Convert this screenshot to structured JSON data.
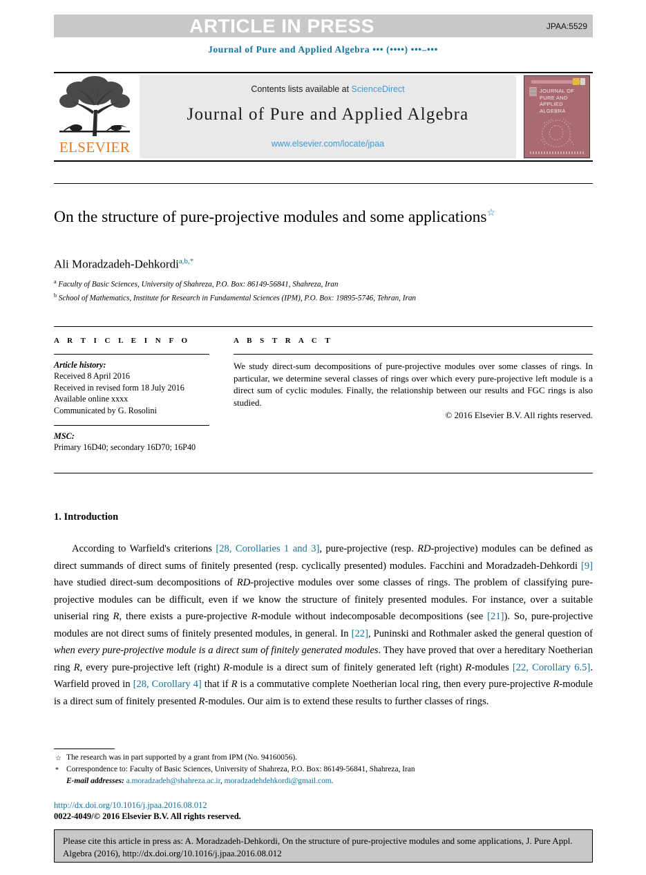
{
  "banner": {
    "text": "ARTICLE IN PRESS",
    "code": "JPAA:5529",
    "bg_color": "#c8c8c8"
  },
  "running_head": "Journal of Pure and Applied Algebra ••• (••••) •••–•••",
  "masthead": {
    "publisher": "ELSEVIER",
    "publisher_color": "#e87722",
    "contents_prefix": "Contents lists available at ",
    "contents_link": "ScienceDirect",
    "journal_title": "Journal of Pure and Applied Algebra",
    "journal_url": "www.elsevier.com/locate/jpaa",
    "cover_title": "JOURNAL OF PURE AND APPLIED ALGEBRA",
    "cover_color": "#a96a72",
    "link_color": "#3a9bd9"
  },
  "article": {
    "title": "On the structure of pure-projective modules and some applications",
    "title_footnote_mark": "☆",
    "author": "Ali Moradzadeh-Dehkordi",
    "author_superscripts": "a,b,*",
    "affiliations": [
      {
        "mark": "a",
        "text": "Faculty of Basic Sciences, University of Shahreza, P.O. Box: 86149-56841, Shahreza, Iran"
      },
      {
        "mark": "b",
        "text": "School of Mathematics, Institute for Research in Fundamental Sciences (IPM), P.O. Box: 19895-5746, Tehran, Iran"
      }
    ]
  },
  "info": {
    "heading": "A R T I C L E   I N F O",
    "history_label": "Article history:",
    "history_lines": [
      "Received 8 April 2016",
      "Received in revised form 18 July 2016",
      "Available online xxxx",
      "Communicated by G. Rosolini"
    ],
    "msc_label": "MSC:",
    "msc_value": "Primary 16D40; secondary 16D70; 16P40"
  },
  "abstract": {
    "heading": "A B S T R A C T",
    "text": "We study direct-sum decompositions of pure-projective modules over some classes of rings. In particular, we determine several classes of rings over which every pure-projective left module is a direct sum of cyclic modules. Finally, the relationship between our results and FGC rings is also studied.",
    "copyright": "© 2016 Elsevier B.V. All rights reserved."
  },
  "body": {
    "section_heading": "1. Introduction",
    "paragraph_parts": [
      {
        "type": "text",
        "value": "According to Warfield's criterions "
      },
      {
        "type": "link",
        "value": "[28, Corollaries 1 and 3]"
      },
      {
        "type": "text",
        "value": ", pure-projective (resp. "
      },
      {
        "type": "italic",
        "value": "RD"
      },
      {
        "type": "text",
        "value": "-projective) modules can be defined as direct summands of direct sums of finitely presented (resp. cyclically presented) modules. Facchini and Moradzadeh-Dehkordi "
      },
      {
        "type": "link",
        "value": "[9]"
      },
      {
        "type": "text",
        "value": " have studied direct-sum decompositions of "
      },
      {
        "type": "italic",
        "value": "RD"
      },
      {
        "type": "text",
        "value": "-projective modules over some classes of rings. The problem of classifying pure-projective modules can be difficult, even if we know the structure of finitely presented modules. For instance, over a suitable uniserial ring "
      },
      {
        "type": "italic",
        "value": "R"
      },
      {
        "type": "text",
        "value": ", there exists a pure-projective "
      },
      {
        "type": "italic",
        "value": "R"
      },
      {
        "type": "text",
        "value": "-module without indecomposable decompositions (see "
      },
      {
        "type": "link",
        "value": "[21]"
      },
      {
        "type": "text",
        "value": "). So, pure-projective modules are not direct sums of finitely presented modules, in general. In "
      },
      {
        "type": "link",
        "value": "[22]"
      },
      {
        "type": "text",
        "value": ", Puninski and Rothmaler asked the general question of "
      },
      {
        "type": "italic",
        "value": "when every pure-projective module is a direct sum of finitely generated modules"
      },
      {
        "type": "text",
        "value": ". They have proved that over a hereditary Noetherian ring "
      },
      {
        "type": "italic",
        "value": "R"
      },
      {
        "type": "text",
        "value": ", every pure-projective left (right) "
      },
      {
        "type": "italic",
        "value": "R"
      },
      {
        "type": "text",
        "value": "-module is a direct sum of finitely generated left (right) "
      },
      {
        "type": "italic",
        "value": "R"
      },
      {
        "type": "text",
        "value": "-modules "
      },
      {
        "type": "link",
        "value": "[22, Corollary 6.5]"
      },
      {
        "type": "text",
        "value": ". Warfield proved in "
      },
      {
        "type": "link",
        "value": "[28, Corollary 4]"
      },
      {
        "type": "text",
        "value": " that if "
      },
      {
        "type": "italic",
        "value": "R"
      },
      {
        "type": "text",
        "value": " is a commutative complete Noetherian local ring, then every pure-projective "
      },
      {
        "type": "italic",
        "value": "R"
      },
      {
        "type": "text",
        "value": "-module is a direct sum of finitely presented "
      },
      {
        "type": "italic",
        "value": "R"
      },
      {
        "type": "text",
        "value": "-modules. Our aim is to extend these results to further classes of rings."
      }
    ]
  },
  "footnotes": {
    "grant": {
      "mark": "☆",
      "text": "The research was in part supported by a grant from IPM (No. 94160056)."
    },
    "correspondence": {
      "mark": "*",
      "text": "Correspondence to: Faculty of Basic Sciences, University of Shahreza, P.O. Box: 86149-56841, Shahreza, Iran"
    },
    "email_label": "E-mail addresses:",
    "email_1": "a.moradzadeh@shahreza.ac.ir",
    "email_2": "moradzadehdehkordi@gmail.com",
    "doi": "http://dx.doi.org/10.1016/j.jpaa.2016.08.012",
    "issn_copyright": "0022-4049/© 2016 Elsevier B.V. All rights reserved.",
    "link_color": "#12739e"
  },
  "cite_box": {
    "text": "Please cite this article in press as: A. Moradzadeh-Dehkordi, On the structure of pure-projective modules and some applications, J. Pure Appl. Algebra (2016), http://dx.doi.org/10.1016/j.jpaa.2016.08.012"
  }
}
